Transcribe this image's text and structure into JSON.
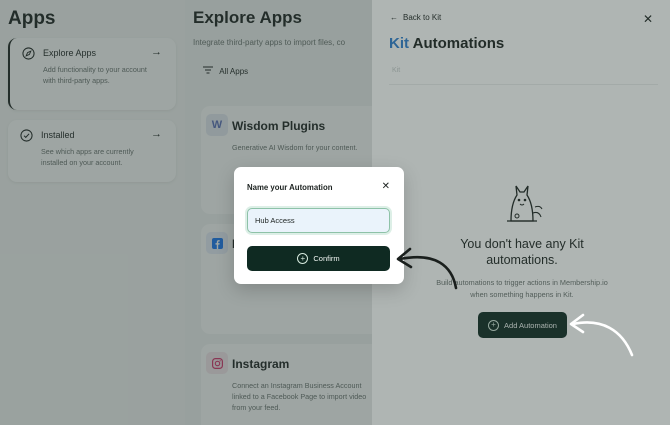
{
  "sidebar": {
    "title": "Apps",
    "cards": [
      {
        "title": "Explore Apps",
        "description": "Add functionality to your account with third-party apps.",
        "icon": "compass-icon",
        "arrow": "→"
      },
      {
        "title": "Installed",
        "description": "See which apps are currently installed on your account.",
        "icon": "check-circle-icon",
        "arrow": "→"
      }
    ]
  },
  "main": {
    "title": "Explore Apps",
    "subtitle": "Integrate third-party apps to import files, co",
    "filter_label": "All Apps",
    "apps": [
      {
        "name": "Wisdom Plugins",
        "description": "Generative AI Wisdom for your content.",
        "logo": "W",
        "logo_color": "#5b6fb8"
      },
      {
        "name": "F",
        "description": "",
        "logo": "f",
        "logo_color": "#1877f2"
      },
      {
        "name": "Instagram",
        "description": "Connect an Instagram Business Account linked to a Facebook Page to import video from your feed.",
        "logo": "instagram",
        "logo_color": "#d6336c"
      }
    ]
  },
  "drawer": {
    "back_label": "Back to Kit",
    "title_accent": "Kit",
    "title_rest": " Automations",
    "faint_text": "Kit",
    "empty_title": "You don't have any Kit automations.",
    "empty_desc": "Build automations to trigger actions in Membership.io when something happens in Kit.",
    "add_button_label": "Add Automation",
    "accent_color": "#2f7fd0"
  },
  "modal": {
    "title": "Name your Automation",
    "input_value": "Hub Access",
    "confirm_label": "Confirm"
  }
}
